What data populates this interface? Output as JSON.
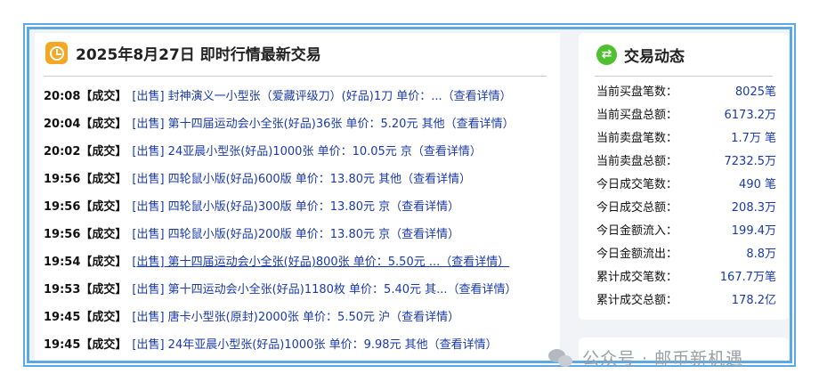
{
  "left_panel": {
    "title": "2025年8月27日 即时行情最新交易",
    "icon": "clock-icon",
    "trades": [
      {
        "time": "20:08",
        "tag": "【成交】",
        "desc": "[出售] 封神演义一小型张（爱藏评级刀）(好品)1刀 单价：...（查看详情）",
        "underline": false
      },
      {
        "time": "20:04",
        "tag": "【成交】",
        "desc": "[出售] 第十四届运动会小全张(好品)36张 单价：5.20元 其他（查看详情）",
        "underline": false
      },
      {
        "time": "20:02",
        "tag": "【成交】",
        "desc": "[出售] 24亚晨小型张(好品)1000张 单价：10.05元 京（查看详情）",
        "underline": false
      },
      {
        "time": "19:56",
        "tag": "【成交】",
        "desc": "[出售] 四轮鼠小版(好品)600版 单价：13.80元 其他（查看详情）",
        "underline": false
      },
      {
        "time": "19:56",
        "tag": "【成交】",
        "desc": "[出售] 四轮鼠小版(好品)300版 单价：13.80元 京（查看详情）",
        "underline": false
      },
      {
        "time": "19:56",
        "tag": "【成交】",
        "desc": "[出售] 四轮鼠小版(好品)200版 单价：13.80元 京（查看详情）",
        "underline": false
      },
      {
        "time": "19:54",
        "tag": "【成交】",
        "desc": "[出售] 第十四届运动会小全张(好品)800张 单价：5.50元 ...（查看详情）",
        "underline": true
      },
      {
        "time": "19:53",
        "tag": "【成交】",
        "desc": "[出售] 第十四运动会小全张(好品)1180枚 单价：5.40元 其...（查看详情）",
        "underline": false
      },
      {
        "time": "19:45",
        "tag": "【成交】",
        "desc": "[出售] 唐卡小型张(原封)2000张 单价：5.50元 沪（查看详情）",
        "underline": false
      },
      {
        "time": "19:45",
        "tag": "【成交】",
        "desc": "[出售] 24年亚晨小型张(好品)1000张 单价：9.98元 其他（查看详情）",
        "underline": false
      }
    ]
  },
  "right_panel": {
    "title": "交易动态",
    "icon": "swap-icon",
    "stats": [
      {
        "label": "当前买盘笔数：",
        "value": "8025笔"
      },
      {
        "label": "当前买盘总额：",
        "value": "6173.2万"
      },
      {
        "label": "当前卖盘笔数：",
        "value": "1.7万 笔"
      },
      {
        "label": "当前卖盘总额：",
        "value": "7232.5万"
      },
      {
        "label": "今日成交笔数：",
        "value": "490 笔"
      },
      {
        "label": "今日成交总额：",
        "value": "208.3万"
      },
      {
        "label": "今日金额流入：",
        "value": "199.4万"
      },
      {
        "label": "今日金额流出：",
        "value": "8.8万"
      },
      {
        "label": "累计成交笔数：",
        "value": "167.7万笔"
      },
      {
        "label": "累计成交总额：",
        "value": "178.2亿"
      }
    ]
  },
  "watermark": {
    "text": "公众号 · 邮币新机遇",
    "icon": "wechat-icon"
  },
  "colors": {
    "border": "#5aa9e6",
    "link": "#1a3aa8",
    "clock_icon": "#f5a623",
    "swap_icon": "#4fc02f"
  }
}
